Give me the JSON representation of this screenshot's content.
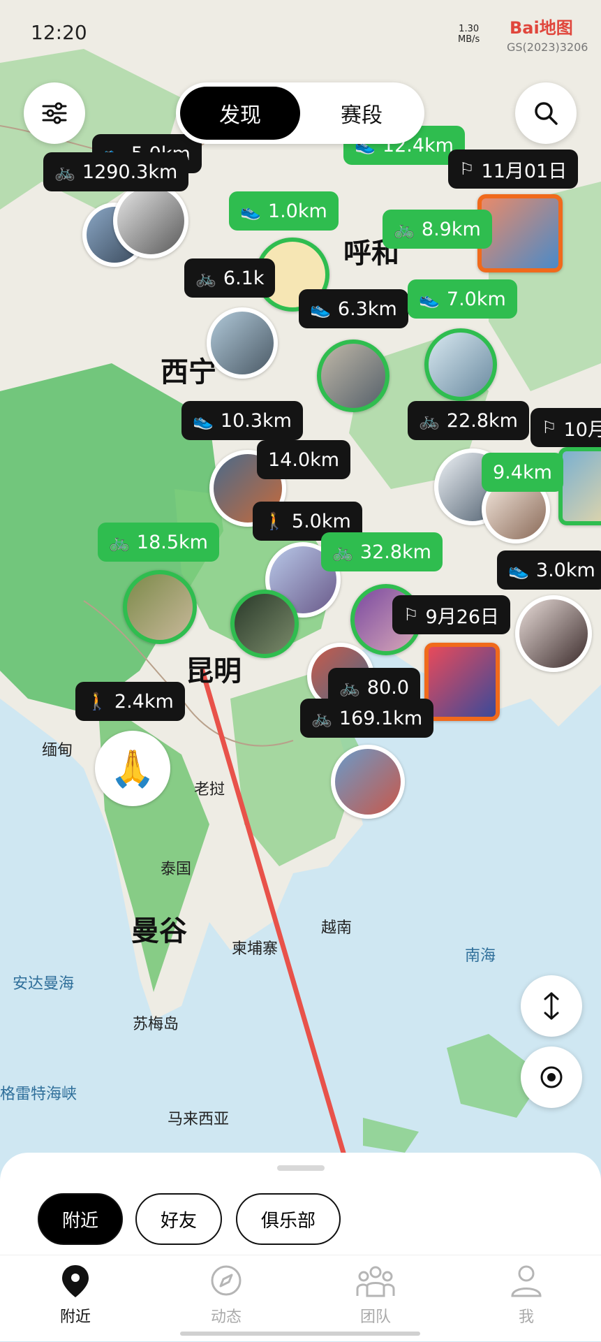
{
  "status_bar": {
    "time": "12:20",
    "net_speed_value": "1.30",
    "net_speed_unit": "MB/s",
    "map_logo": "Bai地图",
    "map_license": "GS(2023)3206"
  },
  "top_tabs": [
    {
      "label": "发现",
      "active": true
    },
    {
      "label": "赛段",
      "active": false
    }
  ],
  "map_labels": {
    "kunming": "昆明",
    "xining": "西宁",
    "huhehaote": "呼和",
    "mandalay": "缅甸",
    "laos": "老挝",
    "thailand": "泰国",
    "bangkok": "曼谷",
    "cambodia": "柬埔寨",
    "vietnam": "越南",
    "south_sea": "南海",
    "andaman": "安达曼海",
    "sumei": "苏梅岛",
    "malacca": "格雷特海峡",
    "malaysia": "马来西亚"
  },
  "activities": [
    {
      "text": "5.0km",
      "type": "run",
      "color": "black"
    },
    {
      "text": "1290.3km",
      "type": "bike",
      "color": "black"
    },
    {
      "text": "12.4km",
      "type": "run",
      "color": "green"
    },
    {
      "text": "11月01日",
      "type": "flag",
      "color": "black"
    },
    {
      "text": "1.0km",
      "type": "run",
      "color": "green"
    },
    {
      "text": "8.9km",
      "type": "bike",
      "color": "green"
    },
    {
      "text": "6.1k",
      "type": "bike",
      "color": "black"
    },
    {
      "text": "6.3km",
      "type": "run",
      "color": "black"
    },
    {
      "text": "7.0km",
      "type": "run",
      "color": "green"
    },
    {
      "text": "10.3km",
      "type": "run",
      "color": "black"
    },
    {
      "text": "22.8km",
      "type": "bike",
      "color": "black"
    },
    {
      "text": "10月",
      "type": "flag",
      "color": "black"
    },
    {
      "text": "14.0km",
      "type": "none",
      "color": "black"
    },
    {
      "text": "9.4km",
      "type": "none",
      "color": "green"
    },
    {
      "text": "18.5km",
      "type": "bike",
      "color": "green"
    },
    {
      "text": "5.0km",
      "type": "hike",
      "color": "black"
    },
    {
      "text": "32.8km",
      "type": "bike",
      "color": "green"
    },
    {
      "text": "3.0km",
      "type": "run",
      "color": "black"
    },
    {
      "text": "9月26日",
      "type": "flag",
      "color": "black"
    },
    {
      "text": "80.0",
      "type": "bike",
      "color": "black"
    },
    {
      "text": "169.1km",
      "type": "bike",
      "color": "black"
    },
    {
      "text": "2.4km",
      "type": "hike",
      "color": "black"
    }
  ],
  "filters": [
    {
      "label": "附近",
      "active": true
    },
    {
      "label": "好友",
      "active": false
    },
    {
      "label": "俱乐部",
      "active": false
    }
  ],
  "bottom_nav": [
    {
      "label": "附近",
      "icon": "location-pin-icon",
      "active": true
    },
    {
      "label": "动态",
      "icon": "compass-icon",
      "active": false
    },
    {
      "label": "团队",
      "icon": "team-icon",
      "active": false
    },
    {
      "label": "我",
      "icon": "person-icon",
      "active": false
    }
  ],
  "colors": {
    "accent_green": "#2fbd4f",
    "chip_black": "#141414",
    "annotation_arrow": "#e8524a"
  }
}
